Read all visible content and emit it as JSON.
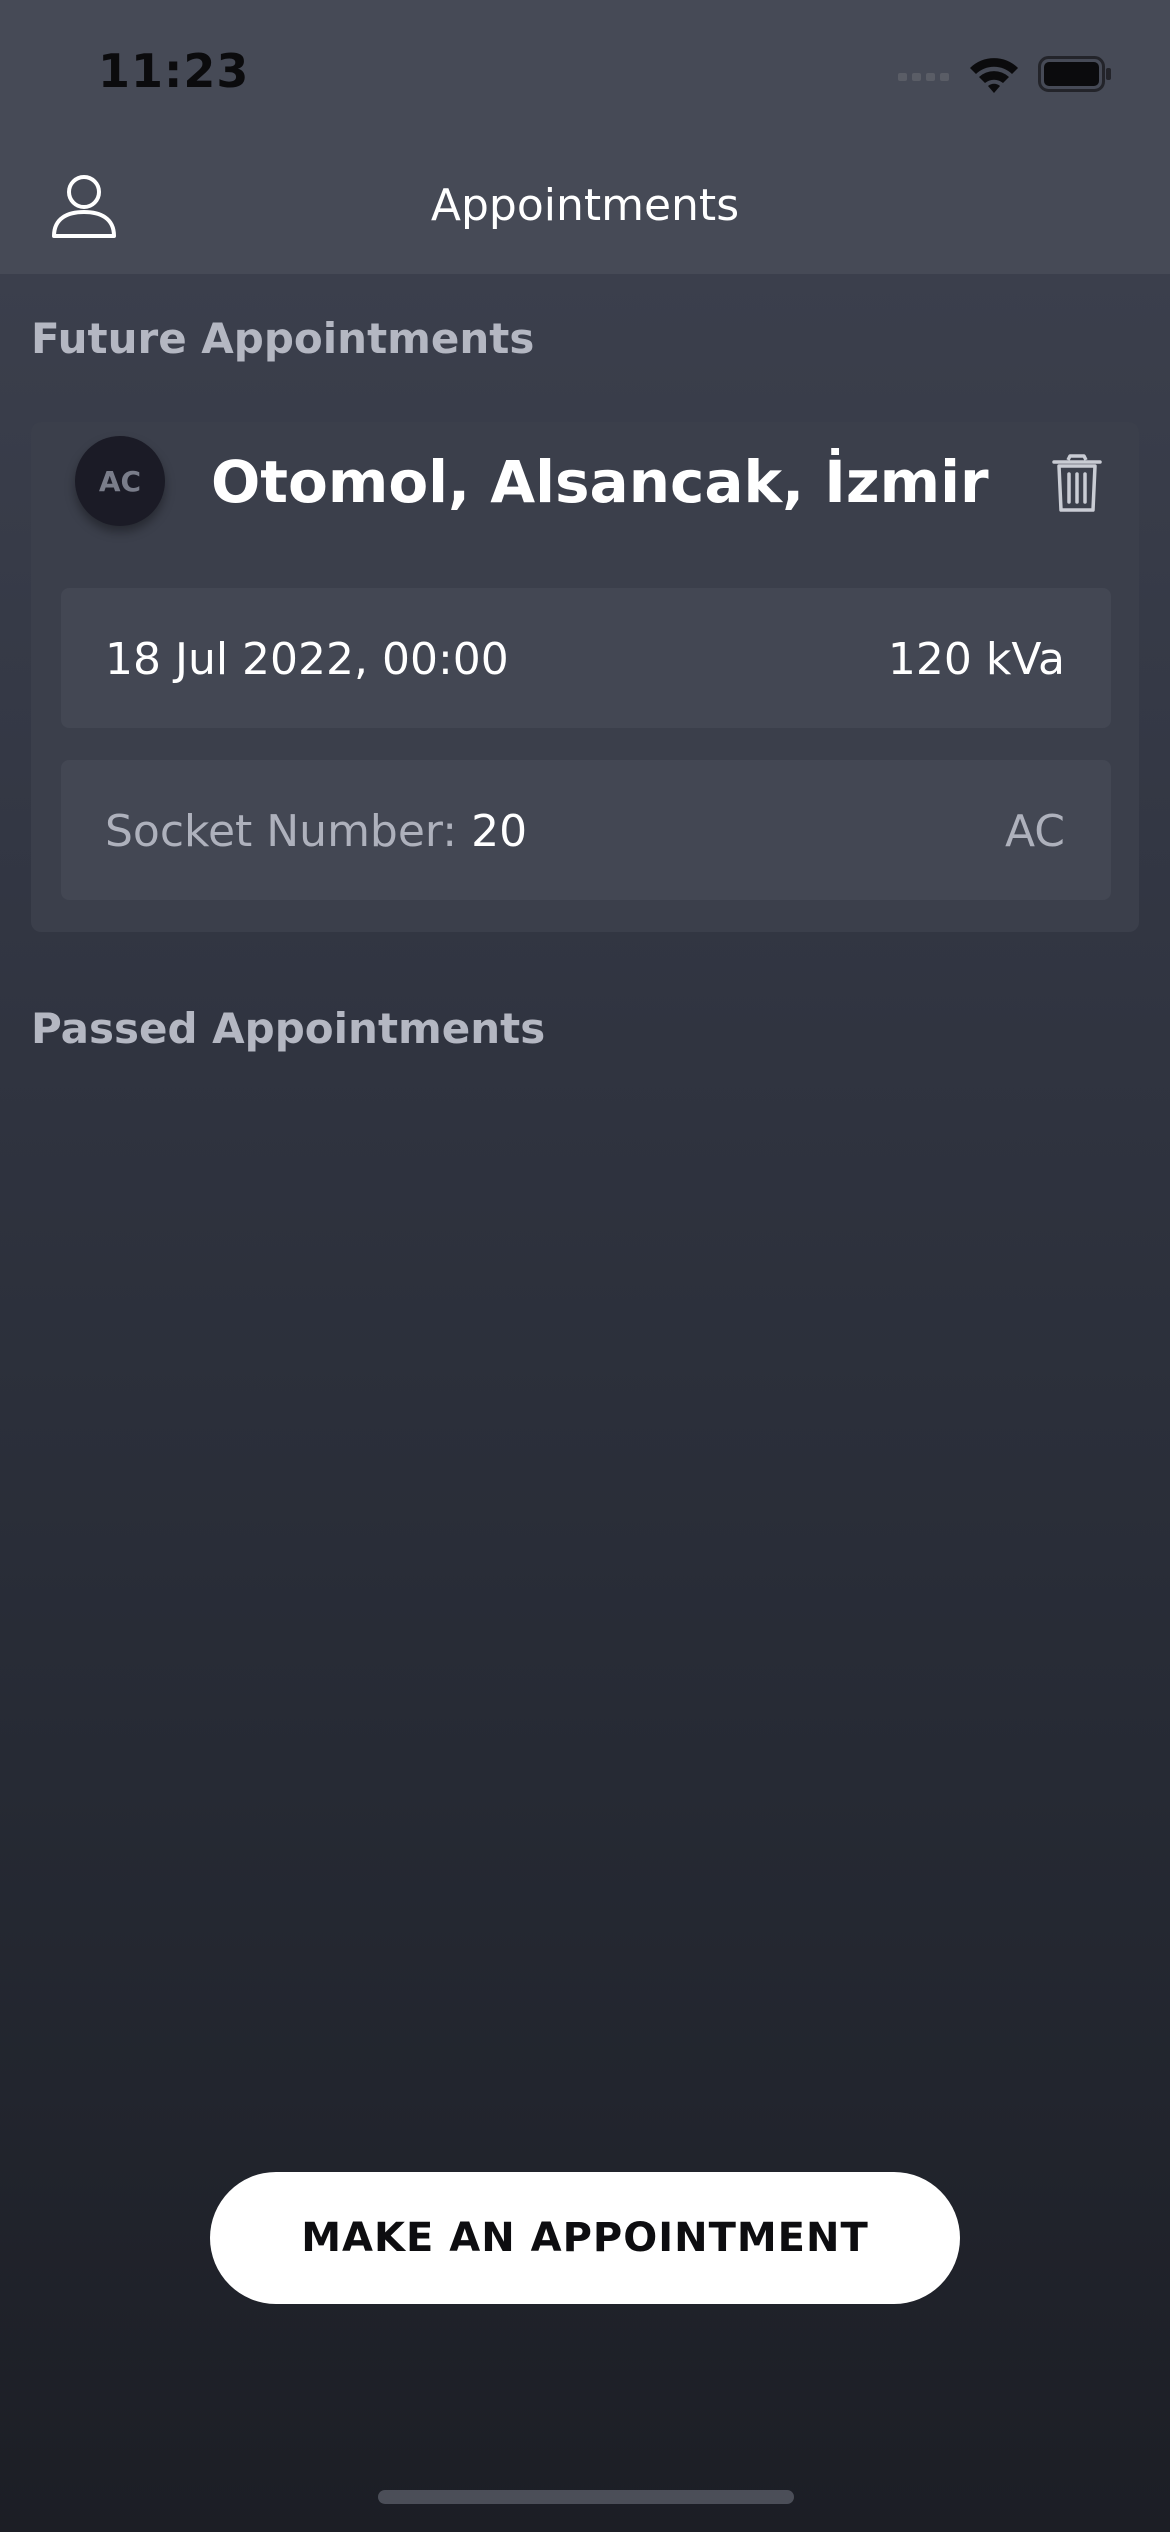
{
  "status_bar": {
    "time": "11:23"
  },
  "header": {
    "title": "Appointments",
    "profile_icon": "person-outline-icon"
  },
  "future_section": {
    "title": "Future Appointments",
    "appointments": [
      {
        "avatar_initials": "AC",
        "station": "Otomol, Alsancak, İzmir",
        "datetime": "18 Jul 2022, 00:00",
        "power": "120 kVa",
        "socket_label": "Socket Number:",
        "socket_number": "20",
        "current_type": "AC",
        "delete_icon": "trash-icon"
      }
    ]
  },
  "passed_section": {
    "title": "Passed Appointments"
  },
  "actions": {
    "make_appointment": "MAKE AN APPOINTMENT"
  },
  "colors": {
    "header_bg": "#464a56",
    "card_bg": "#3b3f4b",
    "row_bg": "#434753",
    "section_title": "#b4b7c2",
    "button_bg": "#ffffff"
  }
}
